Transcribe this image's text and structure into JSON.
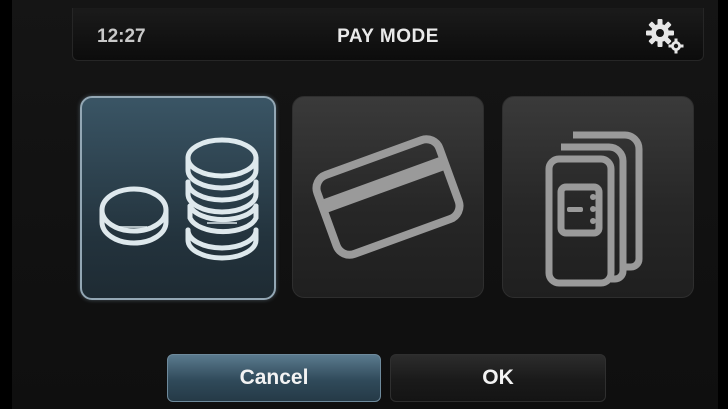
{
  "header": {
    "time": "12:27",
    "title": "PAY MODE",
    "settings_icon": "gears-icon"
  },
  "options": [
    {
      "name": "coins",
      "icon": "coins-icon",
      "selected": true
    },
    {
      "name": "card",
      "icon": "credit-card-icon",
      "selected": false
    },
    {
      "name": "voucher",
      "icon": "voucher-icon",
      "selected": false
    }
  ],
  "buttons": {
    "cancel": "Cancel",
    "ok": "OK"
  },
  "colors": {
    "selected_accent": "#93a7b4",
    "cancel_button": "#3d5a6c",
    "icon_selected": "#e8f2f6",
    "icon_default": "#9a9a9a"
  }
}
